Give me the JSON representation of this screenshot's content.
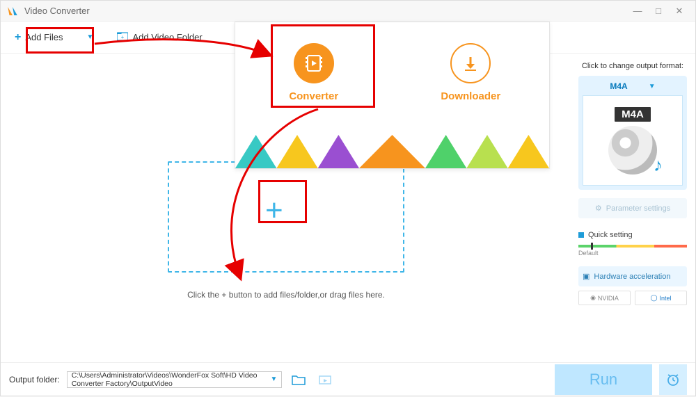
{
  "title": "Video Converter",
  "toolbar": {
    "add_files": "Add Files",
    "add_folder": "Add Video Folder"
  },
  "callout": {
    "converter": "Converter",
    "downloader": "Downloader"
  },
  "dropzone": {
    "message": "Click the + button to add files/folder,or drag files here."
  },
  "right": {
    "hint": "Click to change output format:",
    "format_selected": "M4A",
    "format_badge": "M4A",
    "parameter_settings": "Parameter settings",
    "quick_setting": "Quick setting",
    "default_label": "Default",
    "hw_accel": "Hardware acceleration",
    "vendor_nvidia": "NVIDIA",
    "vendor_intel": "Intel"
  },
  "bottom": {
    "output_label": "Output folder:",
    "output_path": "C:\\Users\\Administrator\\Videos\\WonderFox Soft\\HD Video Converter Factory\\OutputVideo",
    "run": "Run"
  },
  "colors": {
    "accent": "#1e9cd8",
    "orange": "#f7941e",
    "highlight": "#e60000"
  }
}
